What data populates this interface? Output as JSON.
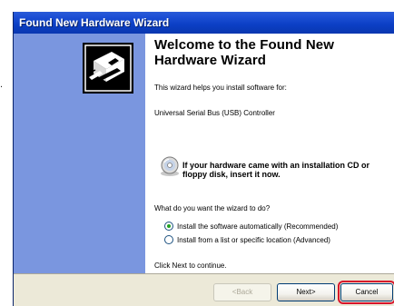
{
  "window": {
    "title": "Found New Hardware Wizard"
  },
  "stray_mark": ".",
  "wizard": {
    "heading": "Welcome to the Found New Hardware Wizard",
    "intro": "This wizard helps you install software for:",
    "device_name": "Universal Serial Bus (USB) Controller",
    "cd_note": "If your hardware came with an installation CD or floppy disk, insert it now.",
    "question": "What do you want the wizard to do?",
    "options": [
      {
        "label": "Install the software automatically (Recommended)",
        "selected": true
      },
      {
        "label": "Install from a list or specific location (Advanced)",
        "selected": false
      }
    ],
    "continue_hint": "Click Next to continue."
  },
  "footer": {
    "back_label": "<Back",
    "next_label": "Next>",
    "cancel_label": "Cancel"
  },
  "icons": {
    "sidebar": "hardware-wizard-icon",
    "cd": "cd-icon"
  },
  "colors": {
    "title_bar": "#0b3fc4",
    "sidebar": "#7a96df",
    "highlight": "#d7142a"
  }
}
